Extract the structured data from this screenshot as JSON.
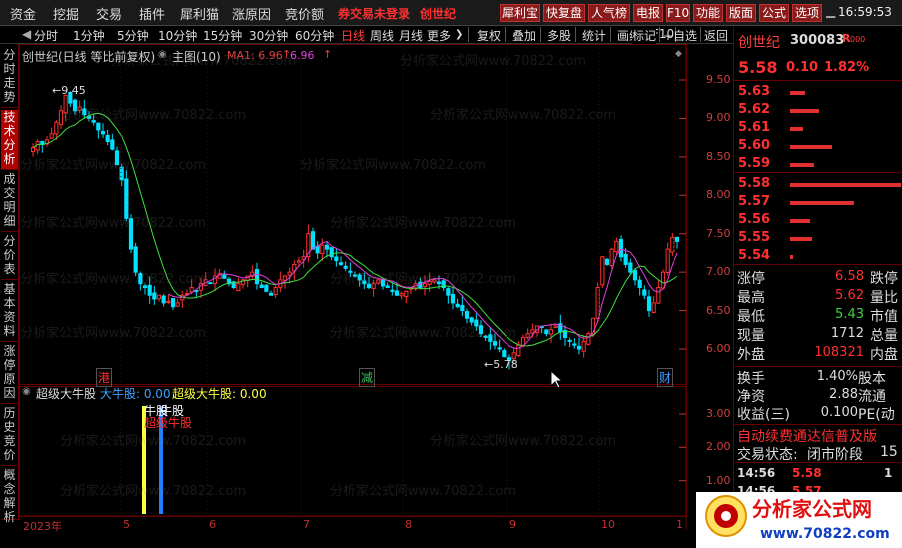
{
  "menu": {
    "items": [
      "资金",
      "挖掘",
      "交易",
      "插件",
      "犀利猫",
      "涨原因",
      "竞价额"
    ],
    "warning": "券交易未登录",
    "stock_short": "创世纪",
    "tool_buttons": [
      "犀利宝",
      "快复盘",
      "人气榜",
      "电报",
      "F10",
      "功能",
      "版面",
      "公式",
      "选项"
    ],
    "clock": "16:59:53"
  },
  "toolbar": {
    "periods": [
      "分时",
      "1分钟",
      "5分钟",
      "10分钟",
      "15分钟",
      "30分钟",
      "60分钟",
      "日线",
      "周线",
      "月线",
      "更多"
    ],
    "more_arrow": "❯",
    "actions": [
      "复权",
      "叠加",
      "多股",
      "统计",
      "画线",
      "F10",
      "标记",
      "+自选",
      "返回"
    ]
  },
  "sidebar": {
    "tabs": [
      "分时走势",
      "技术分析",
      "成交明细",
      "分价表",
      "基本资料",
      "涨停原因",
      "历史竞价",
      "概念解析"
    ]
  },
  "chart": {
    "title": "创世纪(日线 等比前复权)",
    "main_label": "主图(10)",
    "ma_label": "MA1: 6.96",
    "ma_up_arrow": "↑",
    "ma2_value": "6.96",
    "high_annotation": "9.45",
    "low_annotation": "5.78",
    "markers": [
      {
        "text": "港",
        "color": "#ff3030"
      },
      {
        "text": "减",
        "color": "#40c060"
      },
      {
        "text": "财",
        "color": "#40a0ff"
      }
    ],
    "y_axis_labels": [
      "9.50",
      "9.00",
      "8.50",
      "8.00",
      "7.50",
      "7.00",
      "6.50",
      "6.00"
    ],
    "x_axis_labels": [
      "2023年",
      "5",
      "6",
      "7",
      "8",
      "9",
      "10",
      "1"
    ],
    "watermark": "分析家公式网www.70822.com"
  },
  "indicator": {
    "name": "超级大牛股",
    "legend": [
      {
        "text": "大牛股: 0.00",
        "color": "#40a0ff"
      },
      {
        "text": "超级大牛股: 0.00",
        "color": "#ffff40"
      }
    ],
    "signal_label_1": "牛股",
    "signal_label_2": "牛股",
    "signal_label_3": "超级牛股",
    "y_axis_labels": [
      "3.00",
      "2.00",
      "1.00"
    ],
    "x_axis_labels": [
      "2023年",
      "5",
      "6",
      "7",
      "8",
      "9",
      "10",
      "1"
    ]
  },
  "quote": {
    "name": "创世纪",
    "code": "300083",
    "badge": "R",
    "badge_small": "000",
    "price": "5.58",
    "change": "0.10",
    "change_pct": "1.82%",
    "sell_levels": [
      {
        "price": "5.63",
        "bar": 0.09
      },
      {
        "price": "5.62",
        "bar": 0.17
      },
      {
        "price": "5.61",
        "bar": 0.08
      },
      {
        "price": "5.60",
        "bar": 0.25
      },
      {
        "price": "5.59",
        "bar": 0.14
      }
    ],
    "buy_levels": [
      {
        "price": "5.58",
        "bar": 0.66
      },
      {
        "price": "5.57",
        "bar": 0.38
      },
      {
        "price": "5.56",
        "bar": 0.12
      },
      {
        "price": "5.55",
        "bar": 0.13
      },
      {
        "price": "5.54",
        "bar": 0.02
      }
    ],
    "stats": [
      {
        "label": "涨停",
        "value": "6.58",
        "right": "跌停",
        "color": "#ff3030"
      },
      {
        "label": "最高",
        "value": "5.62",
        "right": "量比",
        "color": "#ff3030"
      },
      {
        "label": "最低",
        "value": "5.43",
        "right": "市值",
        "color": "#40d040"
      },
      {
        "label": "现量",
        "value": "1712",
        "right": "总量",
        "color": "#dddddd"
      },
      {
        "label": "外盘",
        "value": "108321",
        "right": "内盘",
        "color": "#ff3030"
      }
    ],
    "stats2": [
      {
        "label": "换手",
        "value": "1.40%",
        "right": "股本"
      },
      {
        "label": "净资",
        "value": "2.88",
        "right": "流通"
      },
      {
        "label": "收益(三)",
        "value": "0.100",
        "right": "PE(动"
      }
    ],
    "promo": "自动续费通达信普及版",
    "trade_status_label": "交易状态:",
    "trade_status_value": "闭市阶段",
    "trade_status_extra": "15",
    "ticks": [
      {
        "time": "14:56",
        "price": "5.58",
        "color": "#ff3030",
        "volume": "1"
      },
      {
        "time": "14:56",
        "price": "5.57",
        "color": "#ff3030",
        "volume": ""
      }
    ]
  },
  "logo": {
    "text": "分析家公式网",
    "url": "www.70822.com"
  },
  "colors": {
    "up": "#ff3030",
    "down": "#00e0ff",
    "ma1": "#40e040",
    "ma2": "#e040e0",
    "panel_border": "#660000"
  }
}
